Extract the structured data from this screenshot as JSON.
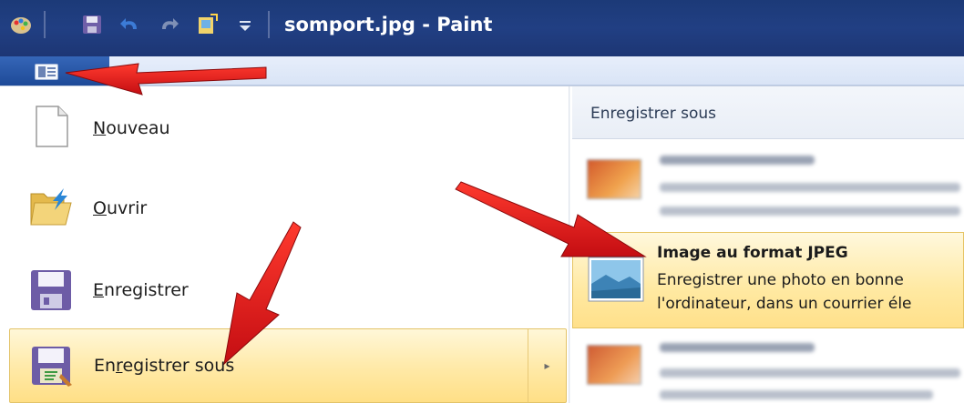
{
  "window": {
    "title": "somport.jpg - Paint"
  },
  "quick_access": {
    "icons": [
      "paint-app-icon",
      "save-icon",
      "undo-icon",
      "redo-icon",
      "new-image-icon",
      "customize-arrow-icon"
    ]
  },
  "app_menu": {
    "items": [
      {
        "label_prefix": "",
        "label_hotkey": "N",
        "label_rest": "ouveau",
        "icon": "new-file-icon"
      },
      {
        "label_prefix": "",
        "label_hotkey": "O",
        "label_rest": "uvrir",
        "icon": "open-folder-icon"
      },
      {
        "label_prefix": "",
        "label_hotkey": "E",
        "label_rest": "nregistrer",
        "icon": "save-disk-icon"
      },
      {
        "label_prefix": "En",
        "label_hotkey": "r",
        "label_rest": "egistrer sous",
        "icon": "save-as-icon"
      }
    ],
    "submenu_arrow": "▸"
  },
  "save_as_panel": {
    "header": "Enregistrer sous",
    "jpeg": {
      "title_prefix": "Image au format ",
      "title_hotkey": "J",
      "title_rest": "PEG",
      "desc_line1": "Enregistrer une photo en bonne",
      "desc_line2": "l'ordinateur, dans un courrier éle"
    }
  },
  "colors": {
    "titlebar": "#1d3674",
    "highlight": "#ffe9a2",
    "annotation_arrow": "#e0141a"
  }
}
